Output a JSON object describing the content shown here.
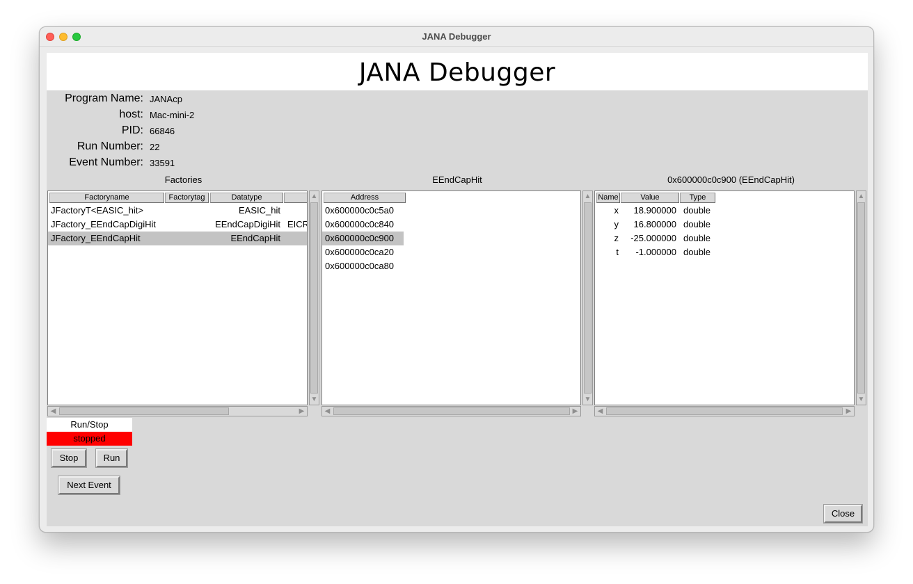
{
  "window": {
    "title": "JANA Debugger"
  },
  "banner": {
    "title": "JANA Debugger"
  },
  "info": {
    "program_name_label": "Program Name:",
    "program_name": "JANAcp",
    "host_label": "host:",
    "host": "Mac-mini-2",
    "pid_label": "PID:",
    "pid": "66846",
    "run_number_label": "Run Number:",
    "run_number": "22",
    "event_number_label": "Event Number:",
    "event_number": "33591"
  },
  "factories": {
    "title": "Factories",
    "columns": [
      "Factoryname",
      "Factorytag",
      "Datatype",
      ""
    ],
    "rows": [
      {
        "name": "JFactoryT<EASIC_hit>",
        "tag": "",
        "datatype": "EASIC_hit",
        "extra": ""
      },
      {
        "name": "JFactory_EEndCapDigiHit",
        "tag": "",
        "datatype": "EEndCapDigiHit",
        "extra": "EICR"
      },
      {
        "name": "JFactory_EEndCapHit",
        "tag": "",
        "datatype": "EEndCapHit",
        "extra": "I"
      }
    ]
  },
  "objects": {
    "title": "EEndCapHit",
    "columns": [
      "Address"
    ],
    "rows": [
      "0x600000c0c5a0",
      "0x600000c0c840",
      "0x600000c0c900",
      "0x600000c0ca20",
      "0x600000c0ca80"
    ]
  },
  "fields": {
    "title": "0x600000c0c900 (EEndCapHit)",
    "columns": [
      "Name",
      "Value",
      "Type"
    ],
    "rows": [
      {
        "name": "x",
        "value": "18.900000",
        "type": "double"
      },
      {
        "name": "y",
        "value": "16.800000",
        "type": "double"
      },
      {
        "name": "z",
        "value": "-25.000000",
        "type": "double"
      },
      {
        "name": "t",
        "value": "-1.000000",
        "type": "double"
      }
    ]
  },
  "controls": {
    "run_stop_label": "Run/Stop",
    "status": "stopped",
    "status_color": "#ff0000",
    "stop_button": "Stop",
    "run_button": "Run",
    "next_event_button": "Next Event",
    "close_button": "Close"
  }
}
